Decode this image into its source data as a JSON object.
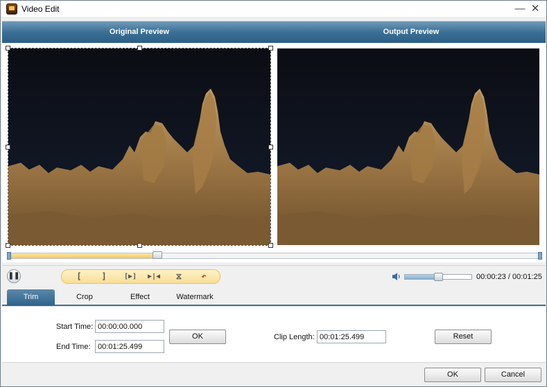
{
  "window": {
    "title": "Video Edit",
    "app_icon": "video-edit-app-icon",
    "minimize_glyph": "—",
    "close_glyph": "✕"
  },
  "preview": {
    "original_label": "Original Preview",
    "output_label": "Output Preview",
    "seek_position": 0.28
  },
  "controls": {
    "play_pause_icon": "pause-icon",
    "edit_buttons": [
      {
        "name": "set-start-button",
        "glyph": "["
      },
      {
        "name": "set-end-button",
        "glyph": "]"
      },
      {
        "name": "play-selection-button",
        "glyph": "[▶]"
      },
      {
        "name": "go-to-start-button",
        "glyph": "▶|◀"
      },
      {
        "name": "split-button",
        "glyph": "⧖"
      },
      {
        "name": "undo-button",
        "glyph": "↶"
      }
    ],
    "volume_level": 0.5,
    "time_current": "00:00:23",
    "time_total": "00:01:25",
    "time_separator": " / "
  },
  "tabs": [
    {
      "label": "Trim",
      "active": true
    },
    {
      "label": "Crop",
      "active": false
    },
    {
      "label": "Effect",
      "active": false
    },
    {
      "label": "Watermark",
      "active": false
    }
  ],
  "trim": {
    "start_time_label": "Start Time:",
    "start_time_value": "00:00:00.000",
    "end_time_label": "End Time:",
    "end_time_value": "00:01:25.499",
    "ok_label": "OK",
    "clip_length_label": "Clip Length:",
    "clip_length_value": "00:01:25.499",
    "reset_label": "Reset"
  },
  "footer": {
    "ok_label": "OK",
    "cancel_label": "Cancel"
  }
}
